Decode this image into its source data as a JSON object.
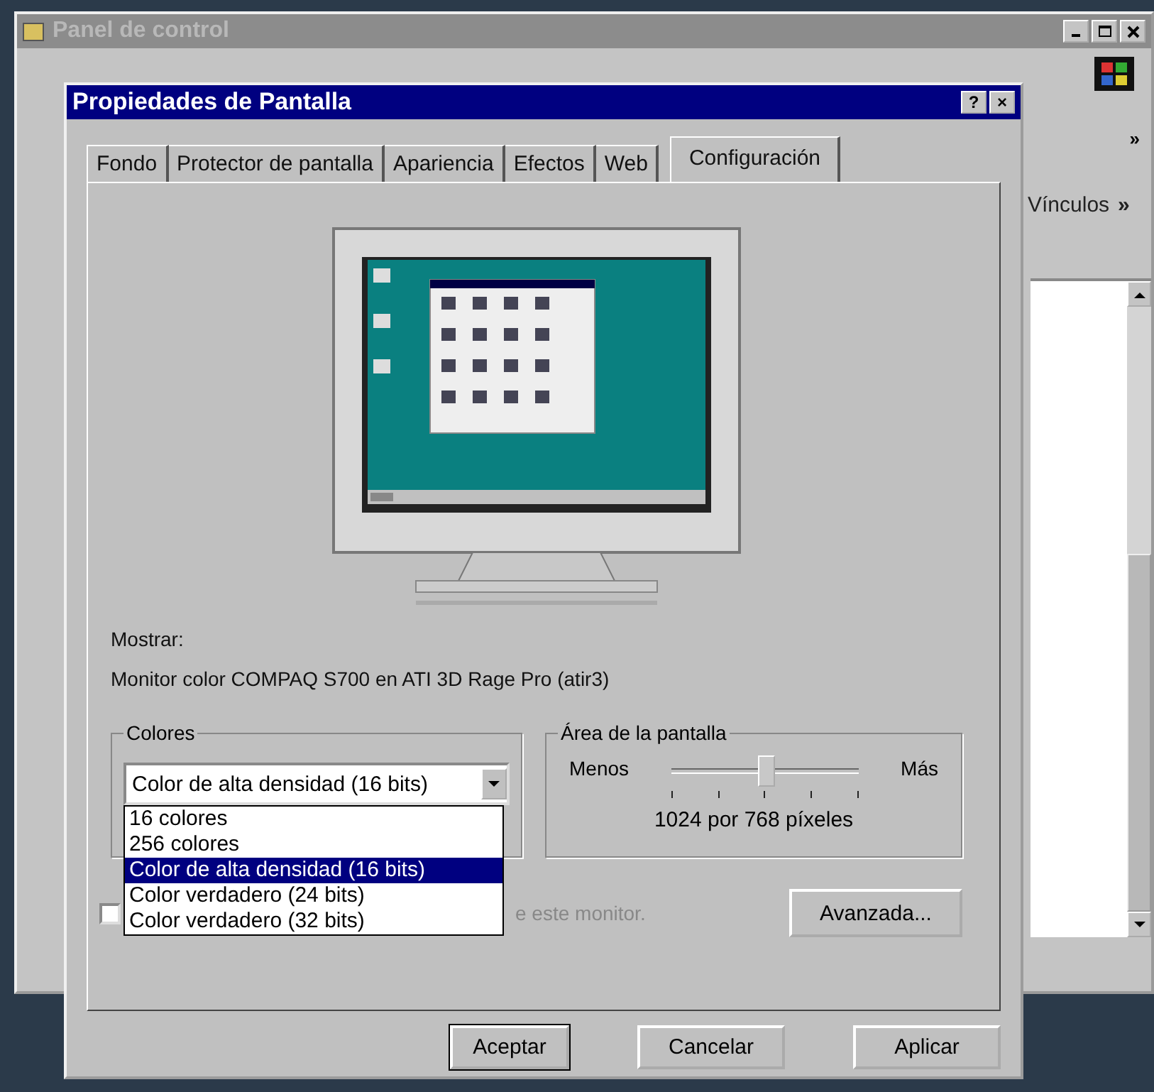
{
  "background_window": {
    "title": "Panel de control",
    "toolbar_chevron": "»",
    "links_label": "Vínculos",
    "links_chevron": "»"
  },
  "dialog": {
    "title": "Propiedades de Pantalla",
    "help_button": "?",
    "close_button": "×"
  },
  "tabs": [
    {
      "label": "Fondo",
      "selected": false
    },
    {
      "label": "Protector de pantalla",
      "selected": false
    },
    {
      "label": "Apariencia",
      "selected": false
    },
    {
      "label": "Efectos",
      "selected": false
    },
    {
      "label": "Web",
      "selected": false
    },
    {
      "label": "Configuración",
      "selected": true
    }
  ],
  "display": {
    "label": "Mostrar:",
    "value": "Monitor color COMPAQ S700 en ATI 3D Rage Pro (atir3)"
  },
  "colors": {
    "legend": "Colores",
    "value": "Color de alta densidad (16 bits)",
    "expanded": true,
    "options": [
      {
        "label": "16 colores",
        "selected": false
      },
      {
        "label": "256 colores",
        "selected": false
      },
      {
        "label": "Color de alta densidad (16 bits)",
        "selected": true
      },
      {
        "label": "Color verdadero (24 bits)",
        "selected": false
      },
      {
        "label": "Color verdadero (32 bits)",
        "selected": false
      }
    ]
  },
  "screen_area": {
    "legend": "Área de la pantalla",
    "min_label": "Menos",
    "max_label": "Más",
    "level": 0.5,
    "reading": "1024 por 768 píxeles"
  },
  "compat": {
    "checked": false,
    "label": "e este monitor."
  },
  "advanced_button": "Avanzada...",
  "buttons": [
    {
      "label": "Aceptar",
      "default": true
    },
    {
      "label": "Cancelar",
      "default": false
    },
    {
      "label": "Aplicar",
      "default": false
    }
  ]
}
